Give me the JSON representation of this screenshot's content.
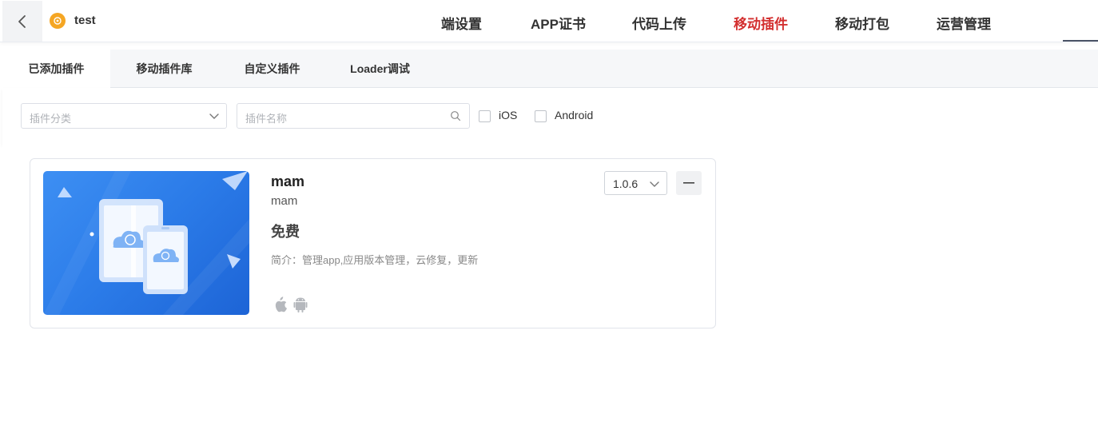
{
  "header": {
    "app_name": "test",
    "nav": [
      {
        "label": "端设置"
      },
      {
        "label": "APP证书"
      },
      {
        "label": "代码上传"
      },
      {
        "label": "移动插件",
        "active": true
      },
      {
        "label": "移动打包"
      },
      {
        "label": "运营管理"
      }
    ],
    "accent_color": "#d32f2f"
  },
  "tabs": [
    {
      "label": "已添加插件",
      "active": true
    },
    {
      "label": "移动插件库"
    },
    {
      "label": "自定义插件"
    },
    {
      "label": "Loader调试"
    }
  ],
  "filters": {
    "category_placeholder": "插件分类",
    "name_placeholder": "插件名称",
    "checkbox_ios": "iOS",
    "checkbox_android": "Android"
  },
  "plugins": [
    {
      "title": "mam",
      "subtitle": "mam",
      "price": "免费",
      "description": "简介：管理app,应用版本管理，云修复，更新",
      "version": "1.0.6",
      "platforms": [
        "apple-icon",
        "android-icon"
      ]
    }
  ]
}
